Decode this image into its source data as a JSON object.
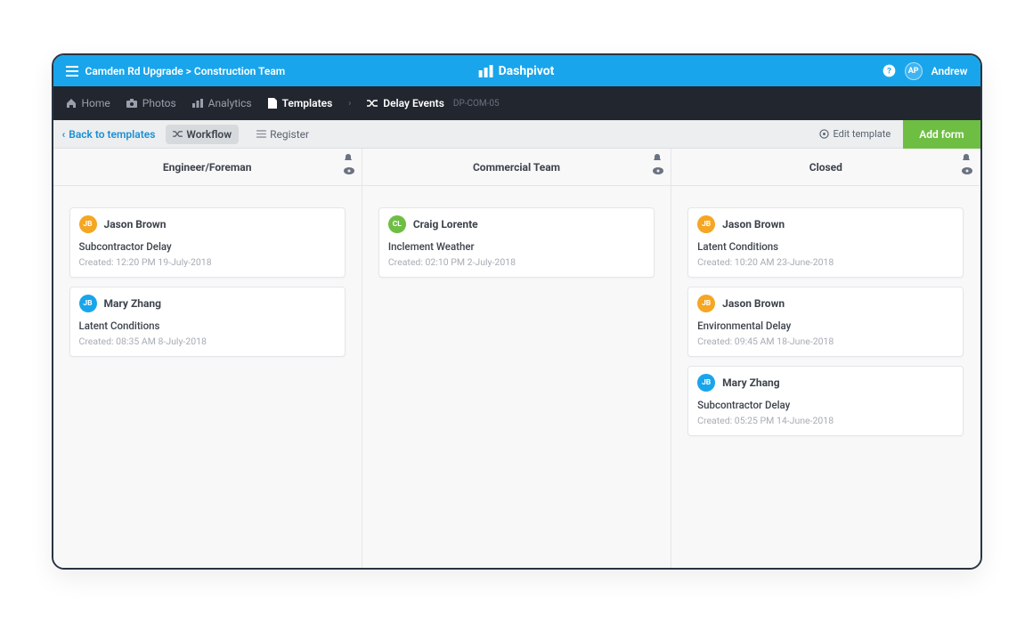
{
  "topbar": {
    "breadcrumb": "Camden Rd Upgrade > Construction Team",
    "brand": "Dashpivot",
    "user_initials": "AP",
    "user_name": "Andrew"
  },
  "darknav": {
    "home": "Home",
    "photos": "Photos",
    "analytics": "Analytics",
    "templates": "Templates",
    "sub": "Delay Events",
    "code": "DP-COM-05"
  },
  "toolbar": {
    "back": "Back to templates",
    "workflow": "Workflow",
    "register": "Register",
    "edit": "Edit template",
    "addform": "Add form"
  },
  "columns": [
    {
      "title": "Engineer/Foreman",
      "cards": [
        {
          "initials": "JB",
          "color": "orange",
          "name": "Jason Brown",
          "title": "Subcontractor Delay",
          "meta": "Created: 12:20 PM 19-July-2018"
        },
        {
          "initials": "JB",
          "color": "blue",
          "name": "Mary Zhang",
          "title": "Latent Conditions",
          "meta": "Created: 08:35 AM 8-July-2018"
        }
      ]
    },
    {
      "title": "Commercial Team",
      "cards": [
        {
          "initials": "CL",
          "color": "green",
          "name": "Craig Lorente",
          "title": "Inclement Weather",
          "meta": "Created: 02:10 PM 2-July-2018"
        }
      ]
    },
    {
      "title": "Closed",
      "cards": [
        {
          "initials": "JB",
          "color": "orange",
          "name": "Jason Brown",
          "title": "Latent Conditions",
          "meta": "Created: 10:20 AM 23-June-2018"
        },
        {
          "initials": "JB",
          "color": "orange",
          "name": "Jason Brown",
          "title": "Environmental Delay",
          "meta": "Created: 09:45 AM 18-June-2018"
        },
        {
          "initials": "JB",
          "color": "blue",
          "name": "Mary Zhang",
          "title": "Subcontractor Delay",
          "meta": "Created: 05:25 PM 14-June-2018"
        }
      ]
    }
  ]
}
